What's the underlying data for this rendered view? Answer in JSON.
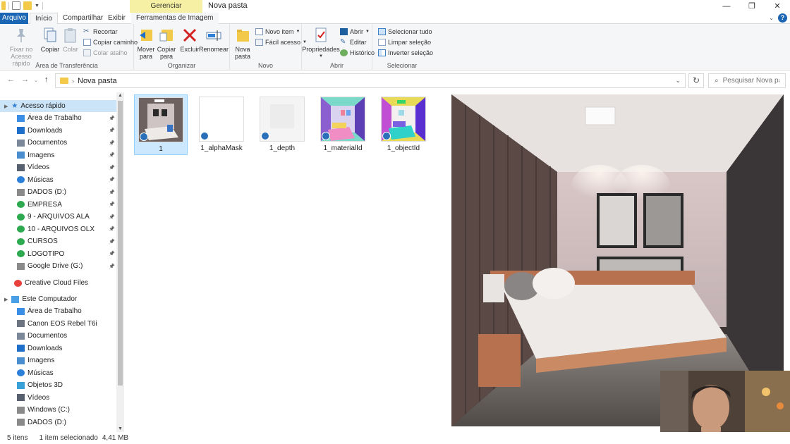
{
  "window": {
    "title": "Nova pasta",
    "contextual_tab": "Gerenciar"
  },
  "tabs": {
    "arquivo": "Arquivo",
    "inicio": "Início",
    "compartilhar": "Compartilhar",
    "exibir": "Exibir",
    "ferramentas": "Ferramentas de Imagem"
  },
  "ribbon": {
    "clipboard": {
      "label": "Área de Transferência",
      "pin_line1": "Fixar no",
      "pin_line2": "Acesso rápido",
      "copy": "Copiar",
      "paste": "Colar",
      "cut": "Recortar",
      "copy_path": "Copiar caminho",
      "paste_shortcut": "Colar atalho"
    },
    "organize": {
      "label": "Organizar",
      "move_line1": "Mover",
      "move_line2": "para",
      "copy_line1": "Copiar",
      "copy_line2": "para",
      "delete": "Excluir",
      "rename": "Renomear"
    },
    "new": {
      "label": "Novo",
      "folder_line1": "Nova",
      "folder_line2": "pasta",
      "new_item": "Novo item",
      "easy_access": "Fácil acesso"
    },
    "open": {
      "label": "Abrir",
      "properties": "Propriedades",
      "open": "Abrir",
      "edit": "Editar",
      "history": "Histórico"
    },
    "select": {
      "label": "Selecionar",
      "select_all": "Selecionar tudo",
      "select_none": "Limpar seleção",
      "invert": "Inverter seleção"
    }
  },
  "address": {
    "path": "Nova pasta",
    "search_placeholder": "Pesquisar Nova pa..."
  },
  "sidebar": {
    "quick_access": "Acesso rápido",
    "quick_items": [
      {
        "label": "Área de Trabalho",
        "icon": "desktop-icon",
        "color": "#3a8ee6"
      },
      {
        "label": "Downloads",
        "icon": "download-icon",
        "color": "#1e6fc9"
      },
      {
        "label": "Documentos",
        "icon": "documents-icon",
        "color": "#7a8899"
      },
      {
        "label": "Imagens",
        "icon": "pictures-icon",
        "color": "#4b8ecf"
      },
      {
        "label": "Vídeos",
        "icon": "videos-icon",
        "color": "#56606e"
      },
      {
        "label": "Músicas",
        "icon": "music-icon",
        "color": "#2b7fd9"
      },
      {
        "label": "DADOS (D:)",
        "icon": "drive-icon",
        "color": "#8a8a8a"
      },
      {
        "label": "EMPRESA",
        "icon": "folder-sync-icon",
        "color": "#2da94f"
      },
      {
        "label": "9 - ARQUIVOS ALA",
        "icon": "folder-sync-icon",
        "color": "#2da94f"
      },
      {
        "label": "10 - ARQUIVOS OLX",
        "icon": "folder-sync-icon",
        "color": "#2da94f"
      },
      {
        "label": "CURSOS",
        "icon": "folder-sync-icon",
        "color": "#2da94f"
      },
      {
        "label": "LOGOTIPO",
        "icon": "folder-sync-icon",
        "color": "#2da94f"
      },
      {
        "label": "Google Drive (G:)",
        "icon": "drive-icon",
        "color": "#8a8a8a"
      }
    ],
    "creative_cloud": "Creative Cloud Files",
    "this_pc": "Este Computador",
    "pc_items": [
      {
        "label": "Área de Trabalho",
        "icon": "desktop-icon",
        "color": "#3a8ee6"
      },
      {
        "label": "Canon EOS Rebel T6i",
        "icon": "camera-icon",
        "color": "#6b7480"
      },
      {
        "label": "Documentos",
        "icon": "documents-icon",
        "color": "#7a8899"
      },
      {
        "label": "Downloads",
        "icon": "download-icon",
        "color": "#1e6fc9"
      },
      {
        "label": "Imagens",
        "icon": "pictures-icon",
        "color": "#4b8ecf"
      },
      {
        "label": "Músicas",
        "icon": "music-icon",
        "color": "#2b7fd9"
      },
      {
        "label": "Objetos 3D",
        "icon": "3d-objects-icon",
        "color": "#3aa0d8"
      },
      {
        "label": "Vídeos",
        "icon": "videos-icon",
        "color": "#56606e"
      },
      {
        "label": "Windows (C:)",
        "icon": "drive-icon",
        "color": "#8a8a8a"
      },
      {
        "label": "DADOS (D:)",
        "icon": "drive-icon",
        "color": "#8a8a8a"
      }
    ]
  },
  "files": [
    {
      "name": "1",
      "kind": "render",
      "selected": true
    },
    {
      "name": "1_alphaMask",
      "kind": "blank",
      "selected": false
    },
    {
      "name": "1_depth",
      "kind": "depth",
      "selected": false
    },
    {
      "name": "1_materialId",
      "kind": "material",
      "selected": false
    },
    {
      "name": "1_objectId",
      "kind": "object",
      "selected": false
    }
  ],
  "status": {
    "count": "5 itens",
    "selection": "1 item selecionado",
    "size": "4,41 MB"
  },
  "colors": {
    "accent": "#1a66b4",
    "selection": "#cce8ff",
    "contextual_tab": "#f5f0a3"
  }
}
